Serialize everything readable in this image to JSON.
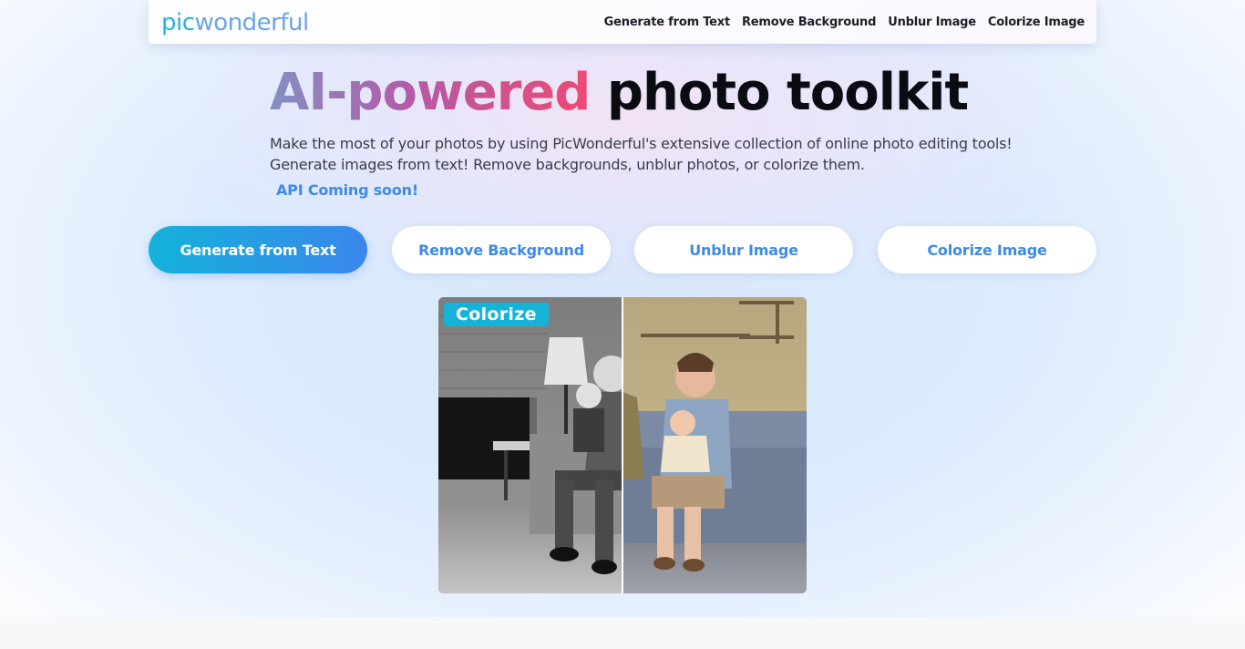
{
  "brand": {
    "logo_part1": "pic",
    "logo_part2": "wonderful"
  },
  "nav": {
    "links": [
      "Generate from Text",
      "Remove Background",
      "Unblur Image",
      "Colorize Image"
    ]
  },
  "hero": {
    "headline_gradient": "AI-powered",
    "headline_plain": "photo toolkit",
    "subtitle_line1": "Make the most of your photos by using PicWonderful's extensive collection of online photo editing tools!",
    "subtitle_line2": "Generate images from text! Remove backgrounds, unblur photos, or colorize them.",
    "api_note": "API Coming soon!"
  },
  "tools": {
    "buttons": [
      "Generate from Text",
      "Remove Background",
      "Unblur Image",
      "Colorize Image"
    ],
    "active_index": 0
  },
  "preview": {
    "tag": "Colorize"
  },
  "colors": {
    "accent_blue": "#3d8be6",
    "accent_cyan": "#13b2d9",
    "headline_gradient_start": "#8390c3",
    "headline_gradient_end": "#ee4a73"
  }
}
